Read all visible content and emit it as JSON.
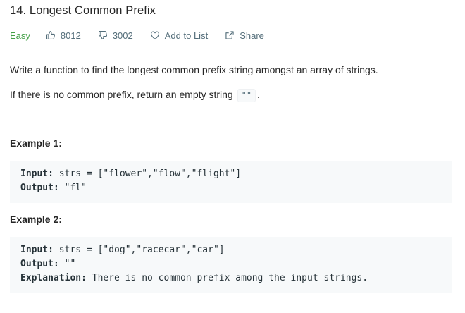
{
  "problem": {
    "title": "14. Longest Common Prefix",
    "difficulty": "Easy",
    "likes": "8012",
    "dislikes": "3002",
    "add_to_list": "Add to List",
    "share": "Share"
  },
  "description": {
    "p1": "Write a function to find the longest common prefix string amongst an array of strings.",
    "p2_before": "If there is no common prefix, return an empty string",
    "p2_code": "\"\"",
    "p2_after": "."
  },
  "examples": [
    {
      "title": "Example 1:",
      "input_label": "Input:",
      "input_value": " strs = [\"flower\",\"flow\",\"flight\"]",
      "output_label": "Output:",
      "output_value": " \"fl\""
    },
    {
      "title": "Example 2:",
      "input_label": "Input:",
      "input_value": " strs = [\"dog\",\"racecar\",\"car\"]",
      "output_label": "Output:",
      "output_value": " \"\"",
      "explanation_label": "Explanation:",
      "explanation_value": " There is no common prefix among the input strings."
    }
  ],
  "icons": {
    "like": "thumbs-up-icon",
    "dislike": "thumbs-down-icon",
    "add_to_list": "heart-icon",
    "share": "share-icon"
  },
  "colors": {
    "easy": "#43a047",
    "meta_text": "#546e7a",
    "code_bg": "#f7f9fa"
  }
}
